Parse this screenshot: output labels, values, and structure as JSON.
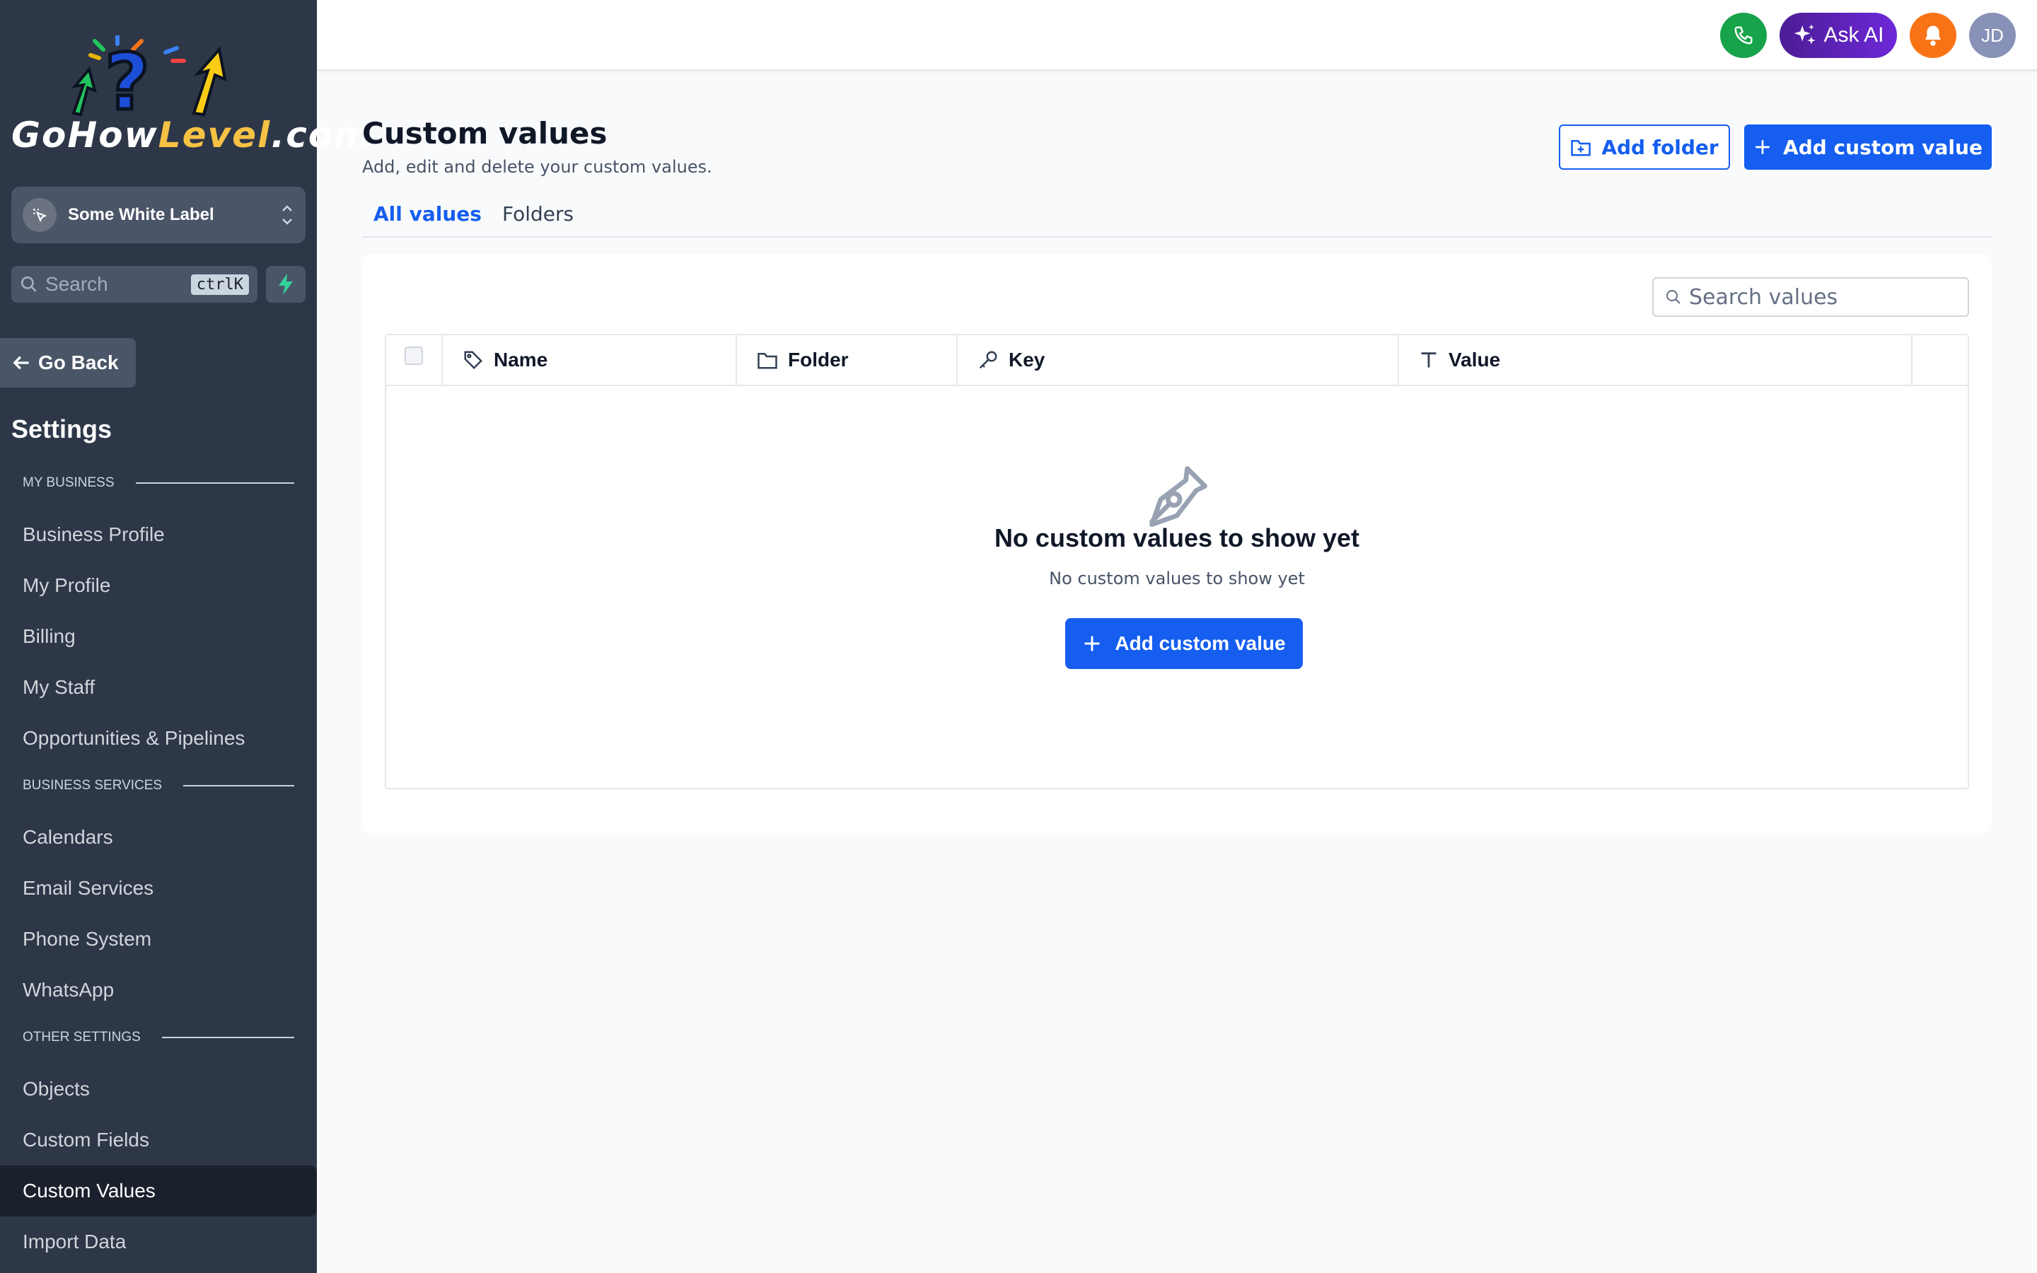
{
  "brand": {
    "logo_text_a": "GoHow",
    "logo_text_b": "Level",
    "logo_text_c": ".com"
  },
  "sidebar": {
    "account_switcher": {
      "name": "Some White Label"
    },
    "search": {
      "label": "Search",
      "shortcut": "ctrlK"
    },
    "go_back": "Go Back",
    "title": "Settings",
    "sections": [
      {
        "heading": "MY BUSINESS",
        "items": [
          "Business Profile",
          "My Profile",
          "Billing",
          "My Staff",
          "Opportunities & Pipelines"
        ]
      },
      {
        "heading": "BUSINESS SERVICES",
        "items": [
          "Calendars",
          "Email Services",
          "Phone System",
          "WhatsApp"
        ]
      },
      {
        "heading": "OTHER SETTINGS",
        "items": [
          "Objects",
          "Custom Fields",
          "Custom Values",
          "Import Data"
        ]
      }
    ],
    "active_item": "Custom Values"
  },
  "topbar": {
    "ask_ai": "Ask AI",
    "avatar_initials": "JD"
  },
  "main": {
    "title": "Custom values",
    "subtitle": "Add, edit and delete your custom values.",
    "add_folder": "Add folder",
    "add_custom_value": "Add custom value",
    "tabs": [
      {
        "label": "All values",
        "active": true
      },
      {
        "label": "Folders",
        "active": false
      }
    ],
    "search_placeholder": "Search values",
    "columns": [
      "Name",
      "Folder",
      "Key",
      "Value"
    ],
    "empty": {
      "title": "No custom values to show yet",
      "subtitle": "No custom values to show yet",
      "button": "Add custom value"
    }
  },
  "colors": {
    "sidebar_bg": "#2d3748",
    "primary": "#155eef",
    "phone": "#16a34a",
    "bell": "#f97316",
    "ai": "#5b21b6"
  }
}
